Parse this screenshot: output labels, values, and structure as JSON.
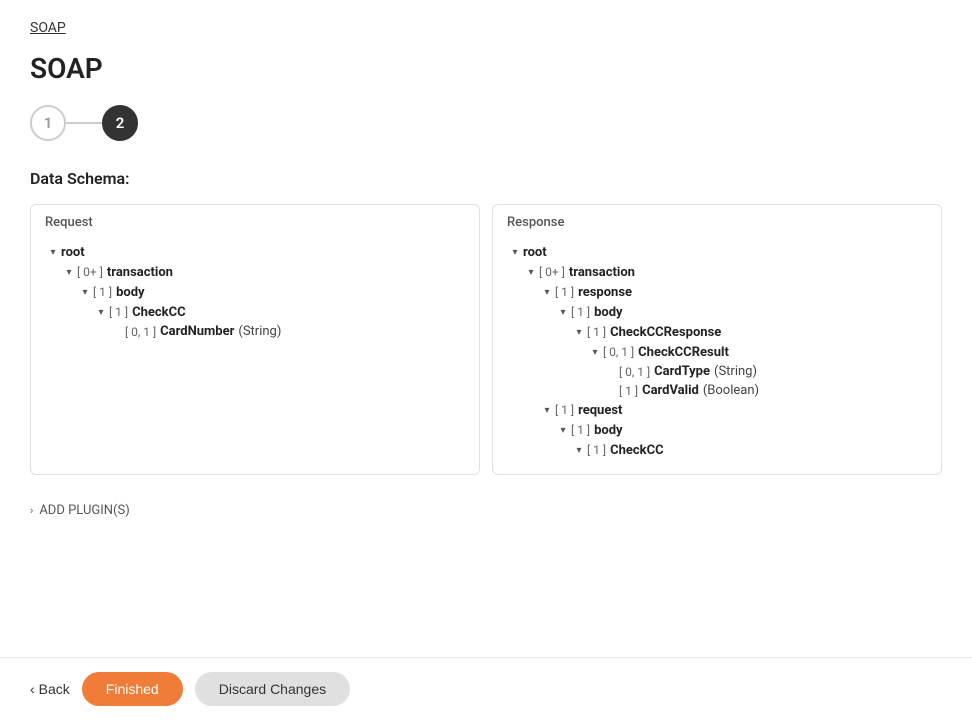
{
  "breadcrumb": {
    "label": "SOAP",
    "href": "#"
  },
  "page": {
    "title": "SOAP"
  },
  "stepper": {
    "steps": [
      {
        "number": "1",
        "state": "inactive"
      },
      {
        "number": "2",
        "state": "active"
      }
    ]
  },
  "schema": {
    "title": "Data Schema:",
    "request": {
      "label": "Request",
      "tree": [
        {
          "indent": 0,
          "toggle": "▾",
          "cardinality": "",
          "name": "root",
          "bold": true,
          "type": ""
        },
        {
          "indent": 1,
          "toggle": "▾",
          "cardinality": "[ 0+ ]",
          "name": "transaction",
          "bold": true,
          "type": ""
        },
        {
          "indent": 2,
          "toggle": "▾",
          "cardinality": "[ 1 ]",
          "name": "body",
          "bold": true,
          "type": ""
        },
        {
          "indent": 3,
          "toggle": "▾",
          "cardinality": "[ 1 ]",
          "name": "CheckCC",
          "bold": true,
          "type": ""
        },
        {
          "indent": 4,
          "toggle": "",
          "cardinality": "[ 0, 1 ]",
          "name": "CardNumber",
          "bold": true,
          "type": "(String)"
        }
      ]
    },
    "response": {
      "label": "Response",
      "tree": [
        {
          "indent": 0,
          "toggle": "▾",
          "cardinality": "",
          "name": "root",
          "bold": true,
          "type": ""
        },
        {
          "indent": 1,
          "toggle": "▾",
          "cardinality": "[ 0+ ]",
          "name": "transaction",
          "bold": true,
          "type": ""
        },
        {
          "indent": 2,
          "toggle": "▾",
          "cardinality": "[ 1 ]",
          "name": "response",
          "bold": true,
          "type": ""
        },
        {
          "indent": 3,
          "toggle": "▾",
          "cardinality": "[ 1 ]",
          "name": "body",
          "bold": true,
          "type": ""
        },
        {
          "indent": 4,
          "toggle": "▾",
          "cardinality": "[ 1 ]",
          "name": "CheckCCResponse",
          "bold": true,
          "type": ""
        },
        {
          "indent": 5,
          "toggle": "▾",
          "cardinality": "[ 0, 1 ]",
          "name": "CheckCCResult",
          "bold": true,
          "type": ""
        },
        {
          "indent": 6,
          "toggle": "",
          "cardinality": "[ 0, 1 ]",
          "name": "CardType",
          "bold": true,
          "type": "(String)"
        },
        {
          "indent": 6,
          "toggle": "",
          "cardinality": "[ 1 ]",
          "name": "CardValid",
          "bold": true,
          "type": "(Boolean)"
        },
        {
          "indent": 2,
          "toggle": "▾",
          "cardinality": "[ 1 ]",
          "name": "request",
          "bold": true,
          "type": ""
        },
        {
          "indent": 3,
          "toggle": "▾",
          "cardinality": "[ 1 ]",
          "name": "body",
          "bold": true,
          "type": ""
        },
        {
          "indent": 4,
          "toggle": "▾",
          "cardinality": "[ 1 ]",
          "name": "CheckCC",
          "bold": true,
          "type": ""
        }
      ]
    }
  },
  "add_plugin": {
    "label": "ADD PLUGIN(S)"
  },
  "footer": {
    "back_label": "Back",
    "finished_label": "Finished",
    "discard_label": "Discard Changes"
  }
}
